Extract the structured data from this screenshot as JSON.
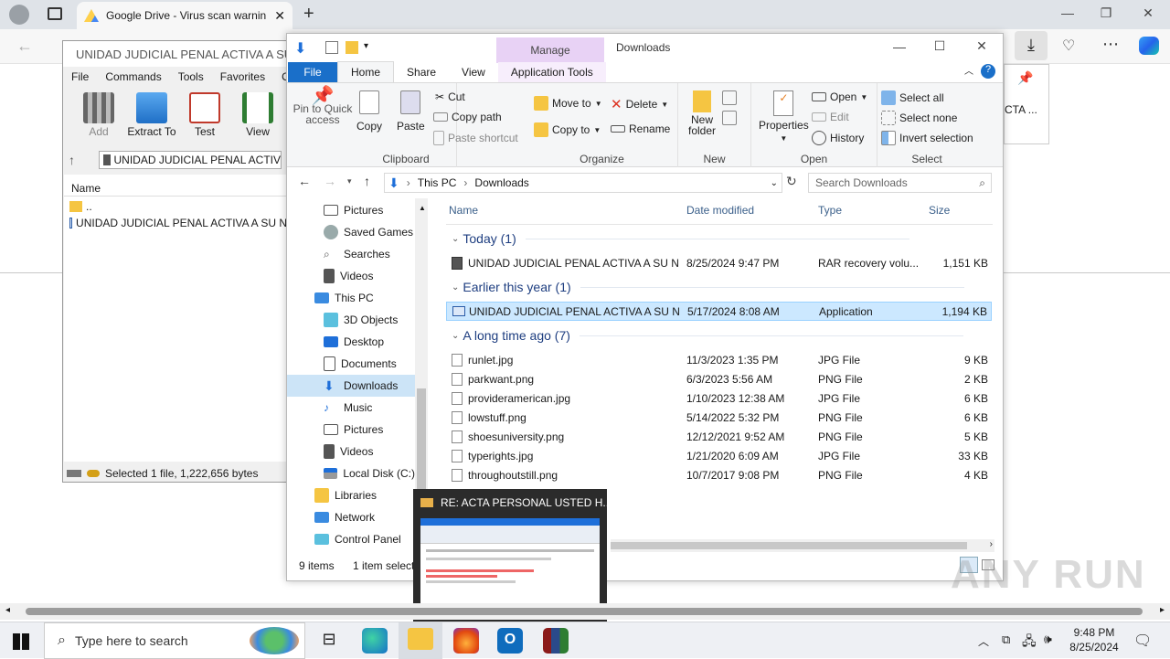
{
  "browser": {
    "tab_title": "Google Drive - Virus scan warnin",
    "side_panel_text": "CTA ..."
  },
  "winrar": {
    "title": "UNIDAD JUDICIAL PENAL ACTIVA A SU N",
    "menu": [
      "File",
      "Commands",
      "Tools",
      "Favorites",
      "Opti"
    ],
    "toolbar": [
      "Add",
      "Extract To",
      "Test",
      "View"
    ],
    "path": "UNIDAD JUDICIAL PENAL ACTIV",
    "column_name": "Name",
    "items": [
      "..",
      "UNIDAD JUDICIAL PENAL ACTIVA A SU N"
    ],
    "status": "Selected 1 file, 1,222,656 bytes"
  },
  "explorer": {
    "manage_label": "Manage",
    "title": "Downloads",
    "tabs": [
      "File",
      "Home",
      "Share",
      "View",
      "Application Tools"
    ],
    "ribbon": {
      "pin": "Pin to Quick access",
      "copy": "Copy",
      "paste": "Paste",
      "cut": "Cut",
      "copy_path": "Copy path",
      "paste_shortcut": "Paste shortcut",
      "clipboard": "Clipboard",
      "move_to": "Move to",
      "copy_to": "Copy to",
      "delete": "Delete",
      "rename": "Rename",
      "organize": "Organize",
      "new_folder": "New folder",
      "new": "New",
      "properties": "Properties",
      "open": "Open",
      "edit": "Edit",
      "history": "History",
      "open_group": "Open",
      "select_all": "Select all",
      "select_none": "Select none",
      "invert_selection": "Invert selection",
      "select": "Select"
    },
    "address": {
      "root": "This PC",
      "folder": "Downloads"
    },
    "search_placeholder": "Search Downloads",
    "nav": [
      "Pictures",
      "Saved Games",
      "Searches",
      "Videos",
      "This PC",
      "3D Objects",
      "Desktop",
      "Documents",
      "Downloads",
      "Music",
      "Pictures",
      "Videos",
      "Local Disk (C:)",
      "Libraries",
      "Network",
      "Control Panel"
    ],
    "columns": {
      "name": "Name",
      "date": "Date modified",
      "type": "Type",
      "size": "Size"
    },
    "groups": [
      "Today (1)",
      "Earlier this year (1)",
      "A long time ago (7)"
    ],
    "files": [
      {
        "name": "UNIDAD JUDICIAL PENAL ACTIVA A SU N...",
        "date": "8/25/2024 9:47 PM",
        "type": "RAR recovery volu...",
        "size": "1,151 KB"
      },
      {
        "name": "UNIDAD JUDICIAL PENAL ACTIVA A SU N...",
        "date": "5/17/2024 8:08 AM",
        "type": "Application",
        "size": "1,194 KB"
      },
      {
        "name": "runlet.jpg",
        "date": "11/3/2023 1:35 PM",
        "type": "JPG File",
        "size": "9 KB"
      },
      {
        "name": "parkwant.png",
        "date": "6/3/2023 5:56 AM",
        "type": "PNG File",
        "size": "2 KB"
      },
      {
        "name": "provideramerican.jpg",
        "date": "1/10/2023 12:38 AM",
        "type": "JPG File",
        "size": "6 KB"
      },
      {
        "name": "lowstuff.png",
        "date": "5/14/2022 5:32 PM",
        "type": "PNG File",
        "size": "6 KB"
      },
      {
        "name": "shoesuniversity.png",
        "date": "12/12/2021 9:52 AM",
        "type": "PNG File",
        "size": "5 KB"
      },
      {
        "name": "typerights.jpg",
        "date": "1/21/2020 6:09 AM",
        "type": "JPG File",
        "size": "33 KB"
      },
      {
        "name": "throughoutstill.png",
        "date": "10/7/2017 9:08 PM",
        "type": "PNG File",
        "size": "4 KB"
      }
    ],
    "status_items": "9 items",
    "status_selected": "1 item selecte"
  },
  "popup": {
    "title": "RE: ACTA PERSONAL USTED H..."
  },
  "taskbar": {
    "search_placeholder": "Type here to search",
    "time": "9:48 PM",
    "date": "8/25/2024"
  },
  "watermark": "ANY RUN"
}
